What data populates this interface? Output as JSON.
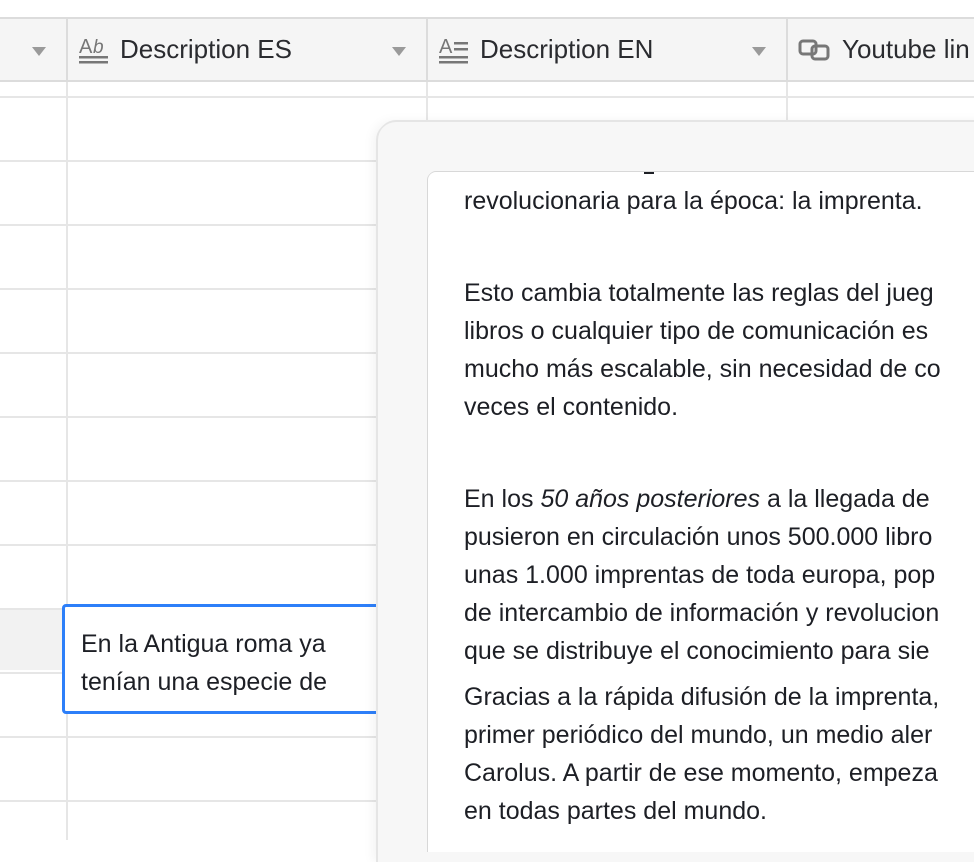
{
  "columns": [
    {
      "label": "Description ES",
      "icon": "long-text-icon"
    },
    {
      "label": "Description EN",
      "icon": "long-text-icon"
    },
    {
      "label": "Youtube lin",
      "icon": "link-icon"
    }
  ],
  "active_cell": {
    "lines": [
      "En la Antigua roma ya",
      "tenían una especie de"
    ]
  },
  "expanded_text": {
    "p1": "revolucionaria para la época: la imprenta.",
    "p2": [
      "Esto cambia totalmente las reglas del jueg",
      "libros o cualquier tipo de comunicación es",
      "mucho más escalable, sin necesidad de co",
      "veces el contenido."
    ],
    "p3_prefix": "En los ",
    "p3_italic": "50 años posteriores",
    "p3_suffix": " a la llegada de",
    "p3": [
      "pusieron en circulación unos 500.000 libro",
      "unas 1.000 imprentas de toda europa, pop",
      "de intercambio de información y revolucion",
      "que se distribuye el conocimiento para sie"
    ],
    "p4": [
      "Gracias a la rápida difusión de la imprenta,",
      "primer periódico del mundo, un medio aler",
      "Carolus. A partir de ese momento, empeza",
      "en todas partes del mundo."
    ]
  },
  "colors": {
    "accent": "#2d7ff9",
    "grid": "#e6e6e6",
    "header_bg": "#f5f5f5"
  }
}
